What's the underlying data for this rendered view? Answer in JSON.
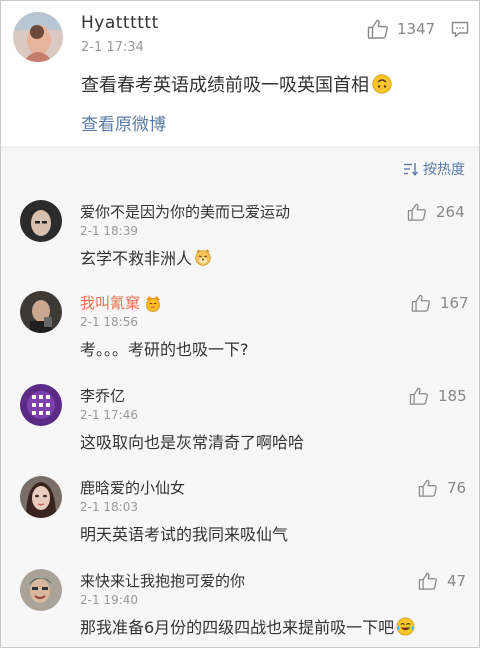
{
  "post": {
    "username": "Hyatttttt",
    "time": "2-1 17:34",
    "like_count": "1347",
    "text": "查看春考英语成绩前吸一吸英国首相",
    "text_emoji": "upside-down-face-emoji",
    "view_original": "查看原微博"
  },
  "sort": {
    "label": "按热度",
    "icon": "sort-icon"
  },
  "comments": [
    {
      "name": "爱你不是因为你的美而已爱运动",
      "time": "2-1 18:39",
      "likes": "264",
      "text": "玄学不救非洲人",
      "emoji": "dog-face-emoji"
    },
    {
      "name": "我叫氰窠",
      "badge": "vip-badge",
      "time": "2-1 18:56",
      "likes": "167",
      "text": "考。。。考研的也吸一下?"
    },
    {
      "name": "李乔亿",
      "time": "2-1 17:46",
      "likes": "185",
      "text": "这吸取向也是灰常清奇了啊哈哈"
    },
    {
      "name": "鹿晗爱的小仙女",
      "time": "2-1 18:03",
      "likes": "76",
      "text": "明天英语考试的我同来吸仙气"
    },
    {
      "name": "来快来让我抱抱可爱的你",
      "time": "2-1 19:40",
      "likes": "47",
      "text": "那我准备6月份的四级四战也来提前吸一下吧",
      "emoji": "laughing-tears-emoji"
    }
  ],
  "colors": {
    "link": "#5a7ba6",
    "vip_name": "#eb7350",
    "muted": "#999999",
    "background": "#f7f7f7"
  }
}
